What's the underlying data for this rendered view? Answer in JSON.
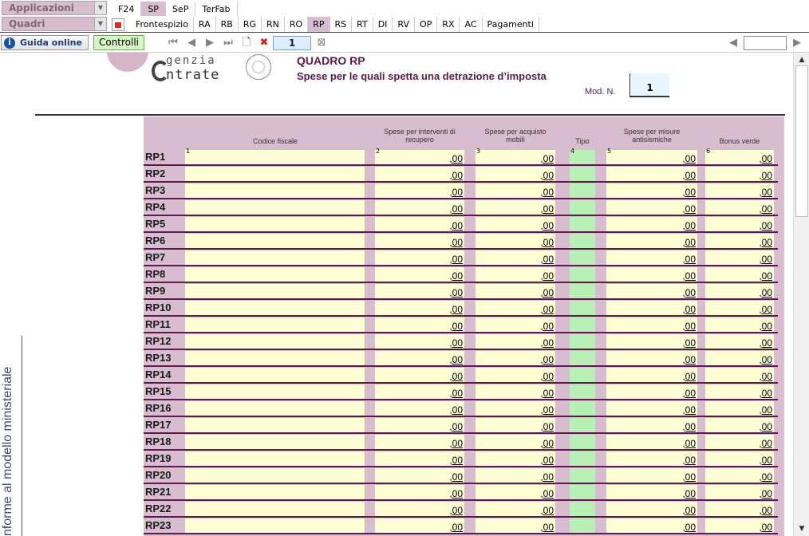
{
  "top_bar": {
    "applicazioni": "Applicazioni",
    "quadri": "Quadri",
    "tabs": [
      {
        "label": "F24",
        "active": false
      },
      {
        "label": "SP",
        "active": true
      },
      {
        "label": "SeP",
        "active": false
      },
      {
        "label": "TerFab",
        "active": false
      }
    ],
    "quadri_tabs": [
      {
        "label": "Frontespizio",
        "active": false
      },
      {
        "label": "RA",
        "active": false
      },
      {
        "label": "RB",
        "active": false
      },
      {
        "label": "RG",
        "active": false
      },
      {
        "label": "RN",
        "active": false
      },
      {
        "label": "RO",
        "active": false
      },
      {
        "label": "RP",
        "active": true
      },
      {
        "label": "RS",
        "active": false
      },
      {
        "label": "RT",
        "active": false
      },
      {
        "label": "DI",
        "active": false
      },
      {
        "label": "RV",
        "active": false
      },
      {
        "label": "OP",
        "active": false
      },
      {
        "label": "RX",
        "active": false
      },
      {
        "label": "AC",
        "active": false
      },
      {
        "label": "Pagamenti",
        "active": false
      }
    ]
  },
  "toolbar": {
    "guida_label": "Guida online",
    "controlli_label": "Controlli",
    "page_number": "1"
  },
  "form": {
    "logo_line1": "genzia",
    "logo_line2": "ntrate",
    "title": "QUADRO RP",
    "subtitle": "Spese per le quali spetta una detrazione d’imposta",
    "mod_label": "Mod. N.",
    "mod_value": "1",
    "side_text": "onforme al modello ministeriale",
    "columns": [
      {
        "num": "1",
        "label": "Codice fiscale"
      },
      {
        "num": "2",
        "label": "Spese per interventi di recupero"
      },
      {
        "num": "3",
        "label": "Spese per acquisto mobili"
      },
      {
        "num": "4",
        "label": "Tipo"
      },
      {
        "num": "5",
        "label": "Spese per misure antisismiche"
      },
      {
        "num": "6",
        "label": "Bonus verde"
      }
    ],
    "empty_amount": ",00",
    "rows": [
      "RP1",
      "RP2",
      "RP3",
      "RP4",
      "RP5",
      "RP6",
      "RP7",
      "RP8",
      "RP9",
      "RP10",
      "RP11",
      "RP12",
      "RP13",
      "RP14",
      "RP15",
      "RP16",
      "RP17",
      "RP18",
      "RP19",
      "RP20",
      "RP21",
      "RP22",
      "RP23"
    ]
  },
  "colors": {
    "accent_mauve": "#d8bcd0",
    "title_color": "#5a1a4a",
    "field_yellow": "#ffffd6",
    "field_green": "#b8f0b8"
  }
}
